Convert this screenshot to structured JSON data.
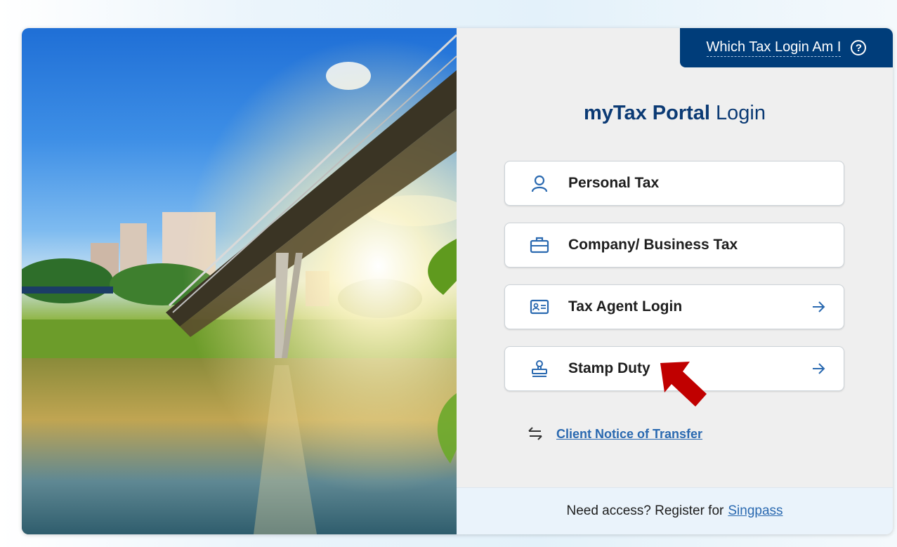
{
  "which_login": {
    "label": "Which Tax Login Am I",
    "icon": "question-circle-icon"
  },
  "title": {
    "brand": "myTax Portal",
    "suffix": "Login"
  },
  "buttons": [
    {
      "label": "Personal Tax",
      "icon": "user-icon",
      "arrow": false
    },
    {
      "label": "Company/ Business Tax",
      "icon": "briefcase-icon",
      "arrow": false
    },
    {
      "label": "Tax Agent Login",
      "icon": "id-card-icon",
      "arrow": true
    },
    {
      "label": "Stamp Duty",
      "icon": "stamp-icon",
      "arrow": true
    }
  ],
  "transfer": {
    "label": "Client Notice of Transfer",
    "icon": "swap-arrows-icon"
  },
  "footer": {
    "text": "Need access? Register for",
    "link": "Singpass"
  },
  "colors": {
    "brand_navy": "#003d7a",
    "title_blue": "#0b3a74",
    "link_blue": "#2a69b0",
    "icon_blue": "#2a69b0",
    "annotation_red": "#c00000"
  }
}
